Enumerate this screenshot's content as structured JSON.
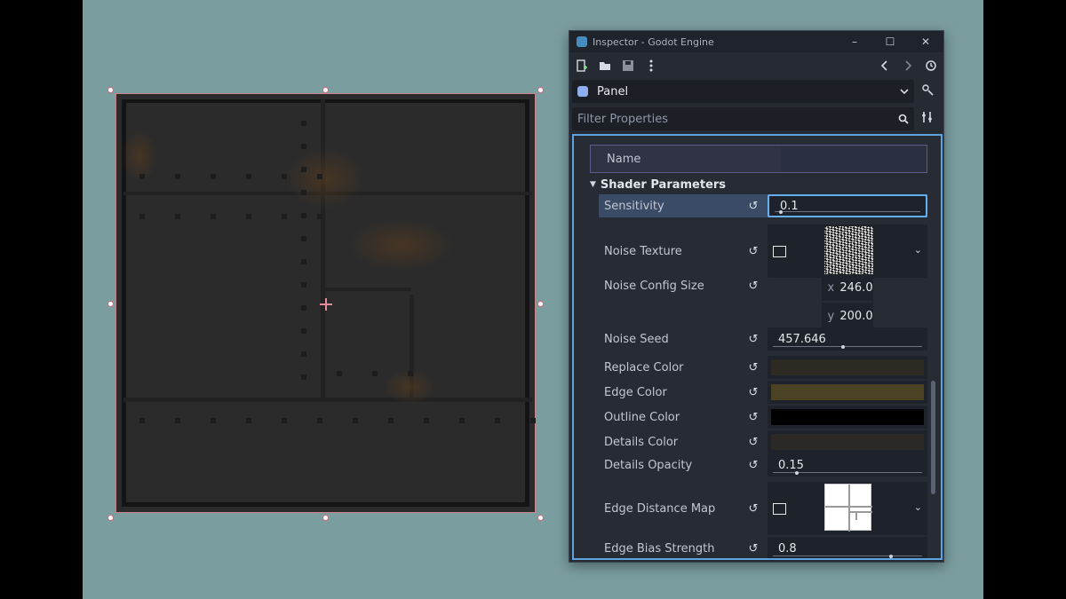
{
  "window": {
    "title": "Inspector - Godot Engine",
    "controls": [
      "–",
      "☐",
      "✕"
    ]
  },
  "toolbar": {
    "icons": [
      "new-resource-icon",
      "open-icon",
      "save-icon",
      "menu-icon",
      "back-icon",
      "forward-icon",
      "history-icon"
    ]
  },
  "node": {
    "name": "Panel"
  },
  "filter": {
    "placeholder": "Filter Properties"
  },
  "name_row": {
    "label": "Name",
    "value": ""
  },
  "section": {
    "title": "Shader Parameters"
  },
  "params": [
    {
      "label": "Sensitivity",
      "value": "0.1",
      "type": "slider",
      "level": 0.03
    },
    {
      "label": "Noise Texture",
      "type": "texture"
    },
    {
      "label": "Noise Config Size",
      "type": "vector2",
      "x": "246.0",
      "y": "200.0"
    },
    {
      "label": "Noise Seed",
      "value": "457.646",
      "type": "slider",
      "level": 0.47
    },
    {
      "label": "Replace Color",
      "type": "color",
      "color": "#2d2a24"
    },
    {
      "label": "Edge Color",
      "type": "color",
      "color": "#4a4222"
    },
    {
      "label": "Outline Color",
      "type": "color",
      "color": "#000000"
    },
    {
      "label": "Details Color",
      "type": "color",
      "color": "#2b2926"
    },
    {
      "label": "Details Opacity",
      "value": "0.15",
      "type": "slider",
      "level": 0.15
    },
    {
      "label": "Edge Distance Map",
      "type": "texture"
    },
    {
      "label": "Edge Bias Strength",
      "value": "0.8",
      "type": "slider",
      "level": 0.8
    }
  ],
  "colors": {
    "accent": "#5fa2e0",
    "selection": "#d86a78",
    "stage": "#7a9ea0"
  }
}
